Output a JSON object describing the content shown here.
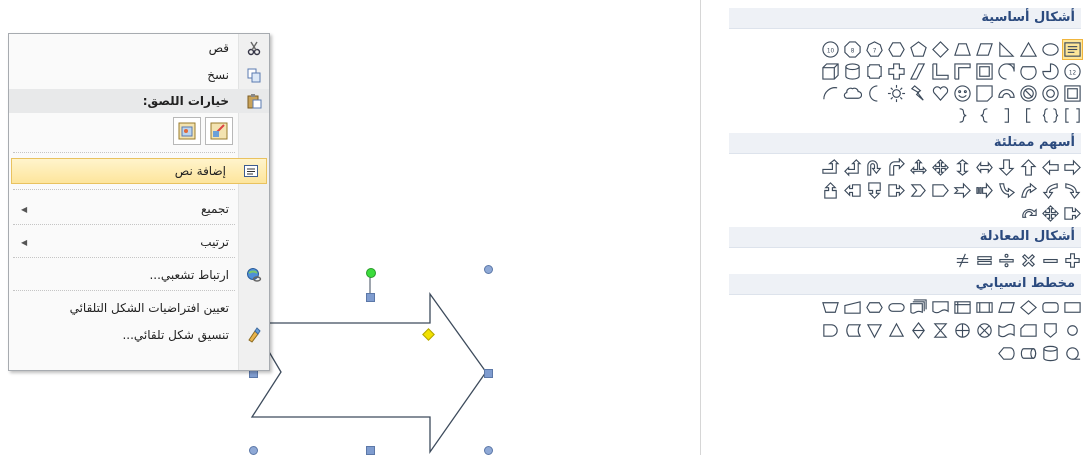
{
  "context_menu": {
    "cut": "قص",
    "copy": "نسخ",
    "paste_options": "خيارات اللصق:",
    "add_text": "إضافة نص",
    "group": "تجميع",
    "order": "ترتيب",
    "hyperlink": "ارتباط تشعبي...",
    "set_default": "تعيين افتراضيات الشكل التلقائي",
    "format_shape": "تنسيق شكل تلقائي..."
  },
  "gallery": {
    "groups": [
      {
        "title": "أشكال أساسية"
      },
      {
        "title": "أسهم ممتلئة"
      },
      {
        "title": "أشكال المعادلة"
      },
      {
        "title": "مخطط انسيابي"
      }
    ]
  },
  "colors": {
    "header_text": "#2b4a7e",
    "shape_stroke": "#3d4b5c",
    "highlight": "#fde699",
    "handle": "#6b8fc9",
    "rotate_handle": "#3cdc3c"
  }
}
